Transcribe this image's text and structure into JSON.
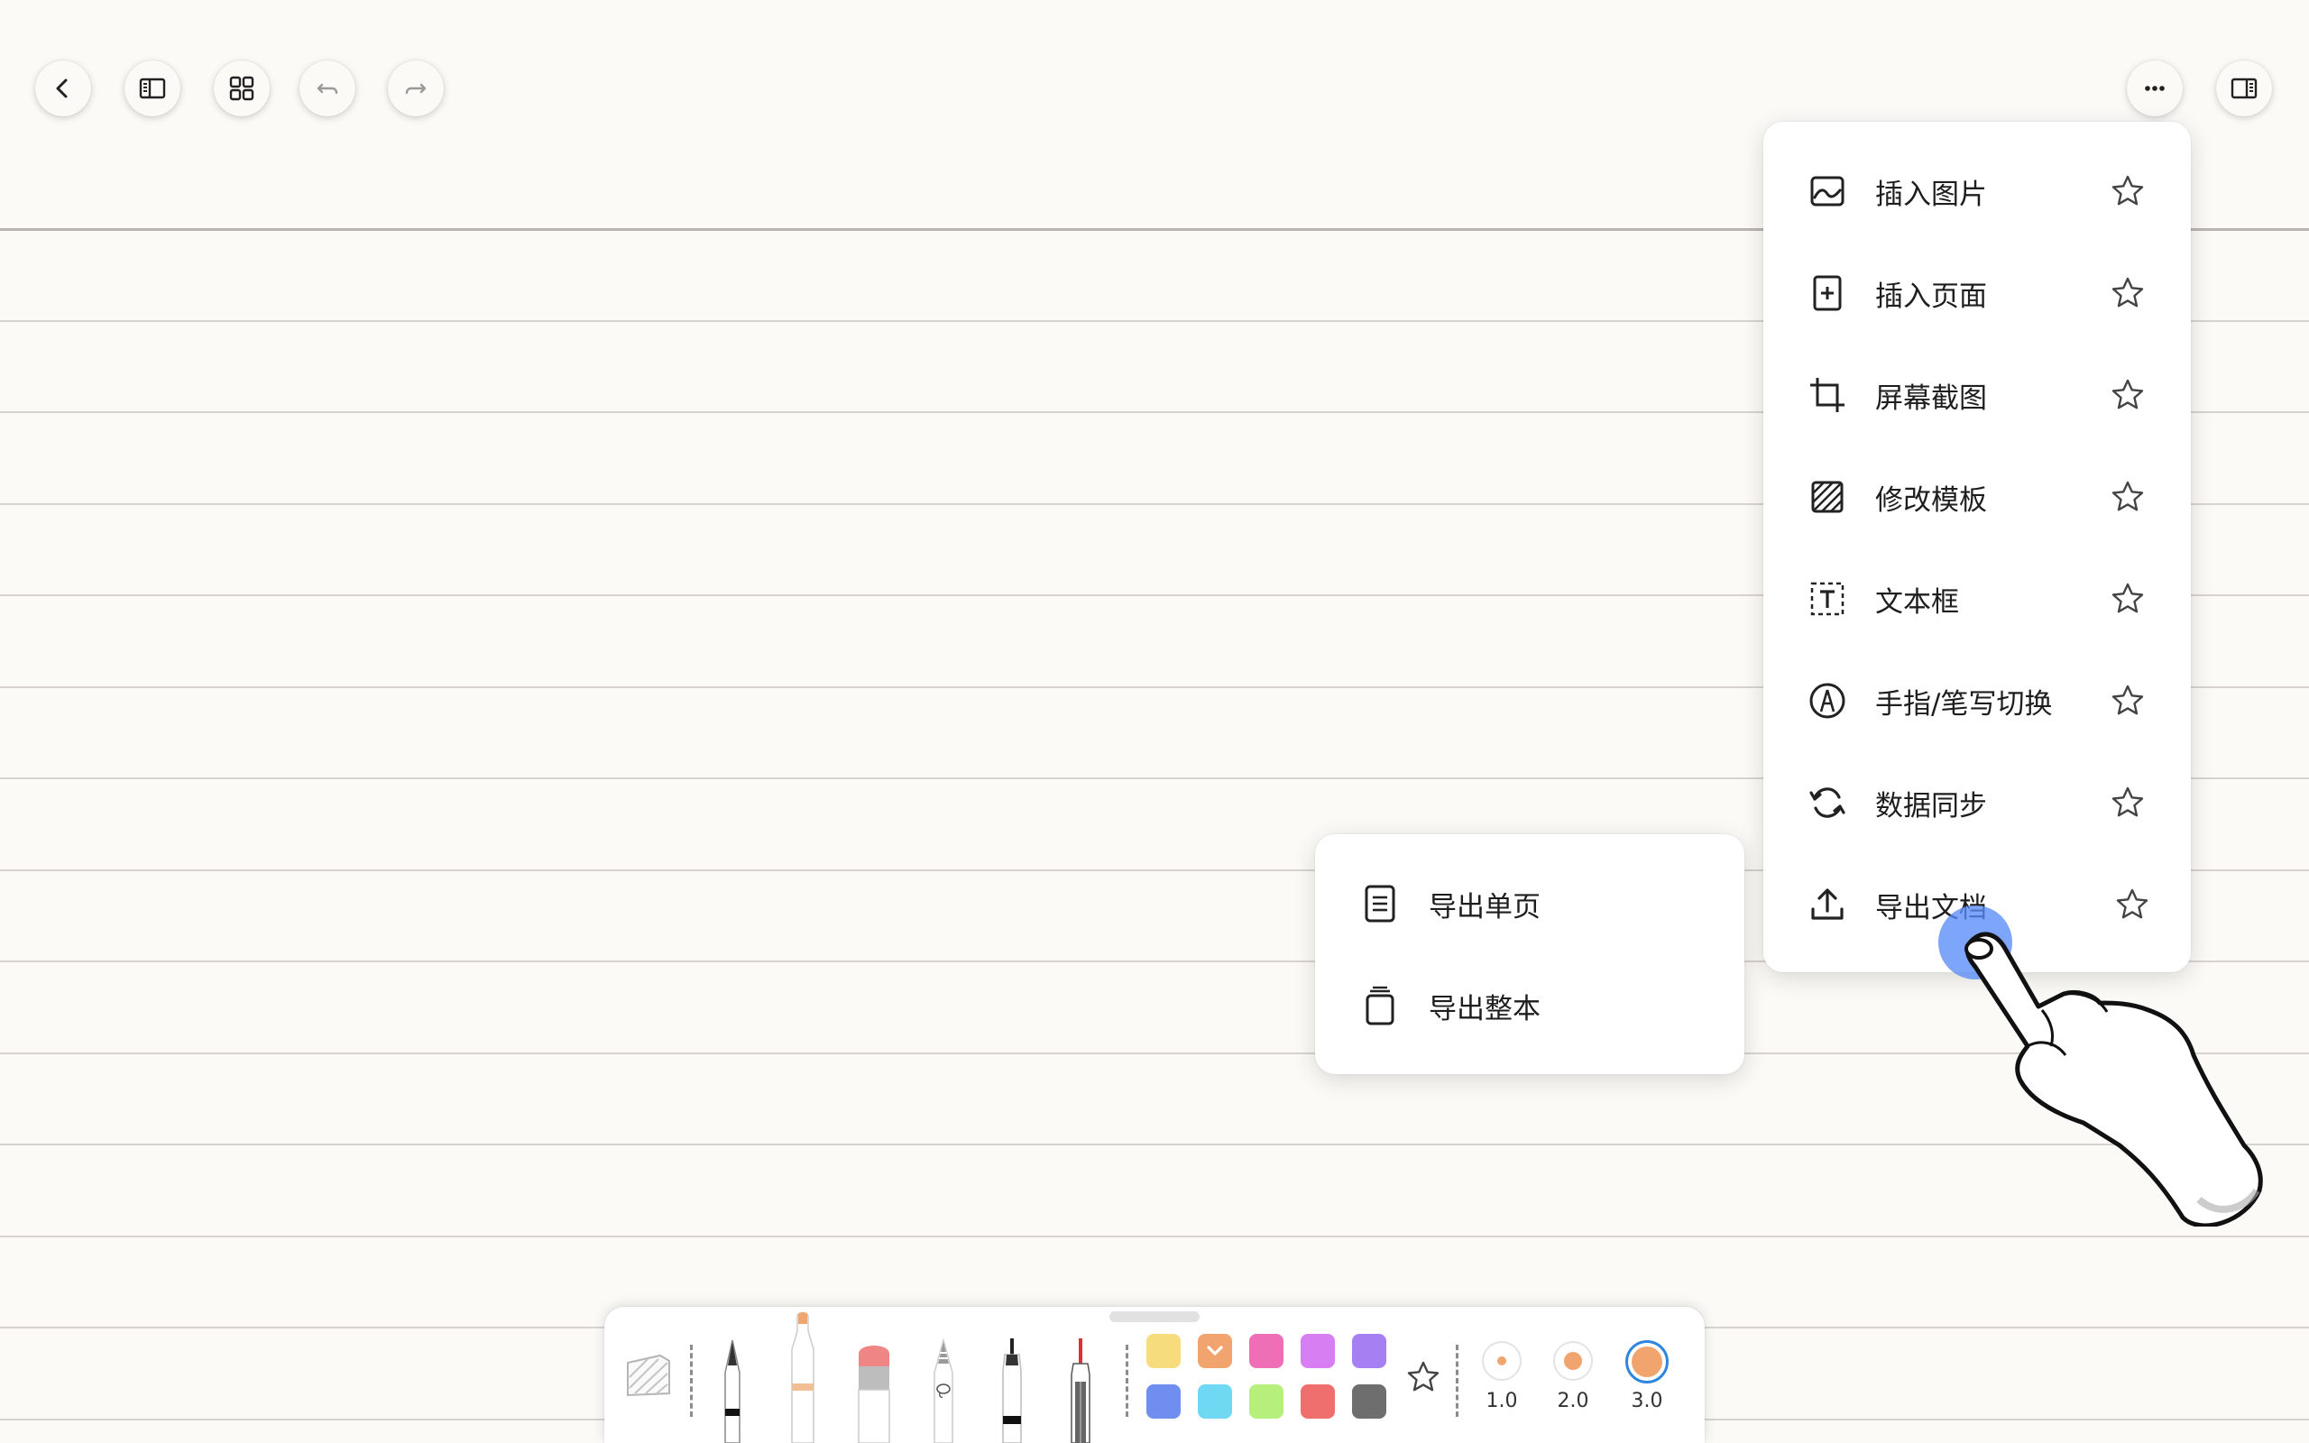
{
  "top_bar": {
    "left_buttons": [
      {
        "icon": "chevron-left-icon"
      },
      {
        "icon": "sidebar-panel-icon"
      },
      {
        "icon": "grid-view-icon"
      },
      {
        "icon": "undo-icon"
      },
      {
        "icon": "redo-icon"
      }
    ],
    "right_buttons": [
      {
        "icon": "more-dots-icon"
      },
      {
        "icon": "right-panel-icon"
      }
    ]
  },
  "more_menu": {
    "items": [
      {
        "label": "插入图片",
        "icon": "image-icon",
        "favorited": false
      },
      {
        "label": "插入页面",
        "icon": "add-page-icon",
        "favorited": false
      },
      {
        "label": "屏幕截图",
        "icon": "crop-icon",
        "favorited": false
      },
      {
        "label": "修改模板",
        "icon": "template-icon",
        "favorited": false
      },
      {
        "label": "文本框",
        "icon": "text-box-icon",
        "favorited": false
      },
      {
        "label": "手指/笔写切换",
        "icon": "pen-nib-icon",
        "favorited": false
      },
      {
        "label": "数据同步",
        "icon": "sync-icon",
        "favorited": false
      },
      {
        "label": "导出文档",
        "icon": "upload-icon",
        "favorited": false
      }
    ]
  },
  "export_submenu": {
    "items": [
      {
        "label": "导出单页",
        "icon": "single-page-icon"
      },
      {
        "label": "导出整本",
        "icon": "whole-book-icon"
      }
    ]
  },
  "toolbar": {
    "tools": [
      {
        "name": "fountain-pen"
      },
      {
        "name": "highlighter"
      },
      {
        "name": "eraser"
      },
      {
        "name": "lasso-pencil"
      },
      {
        "name": "marker-pen"
      },
      {
        "name": "laser-pointer"
      }
    ],
    "colors": [
      {
        "hex": "#f6dc7c"
      },
      {
        "hex": "#f2a46e",
        "selected": true
      },
      {
        "hex": "#ee6fb6"
      },
      {
        "hex": "#d77ef2"
      },
      {
        "hex": "#a680f2"
      },
      {
        "hex": "#6f8ef0"
      },
      {
        "hex": "#6fd8f2"
      },
      {
        "hex": "#b6ef7c"
      },
      {
        "hex": "#ef6f6f"
      },
      {
        "hex": "#6e6e6e"
      }
    ],
    "sizes": [
      {
        "label": "1.0",
        "selected": false
      },
      {
        "label": "2.0",
        "selected": false
      },
      {
        "label": "3.0",
        "selected": true
      }
    ],
    "accent_color": "#f2a46e"
  }
}
